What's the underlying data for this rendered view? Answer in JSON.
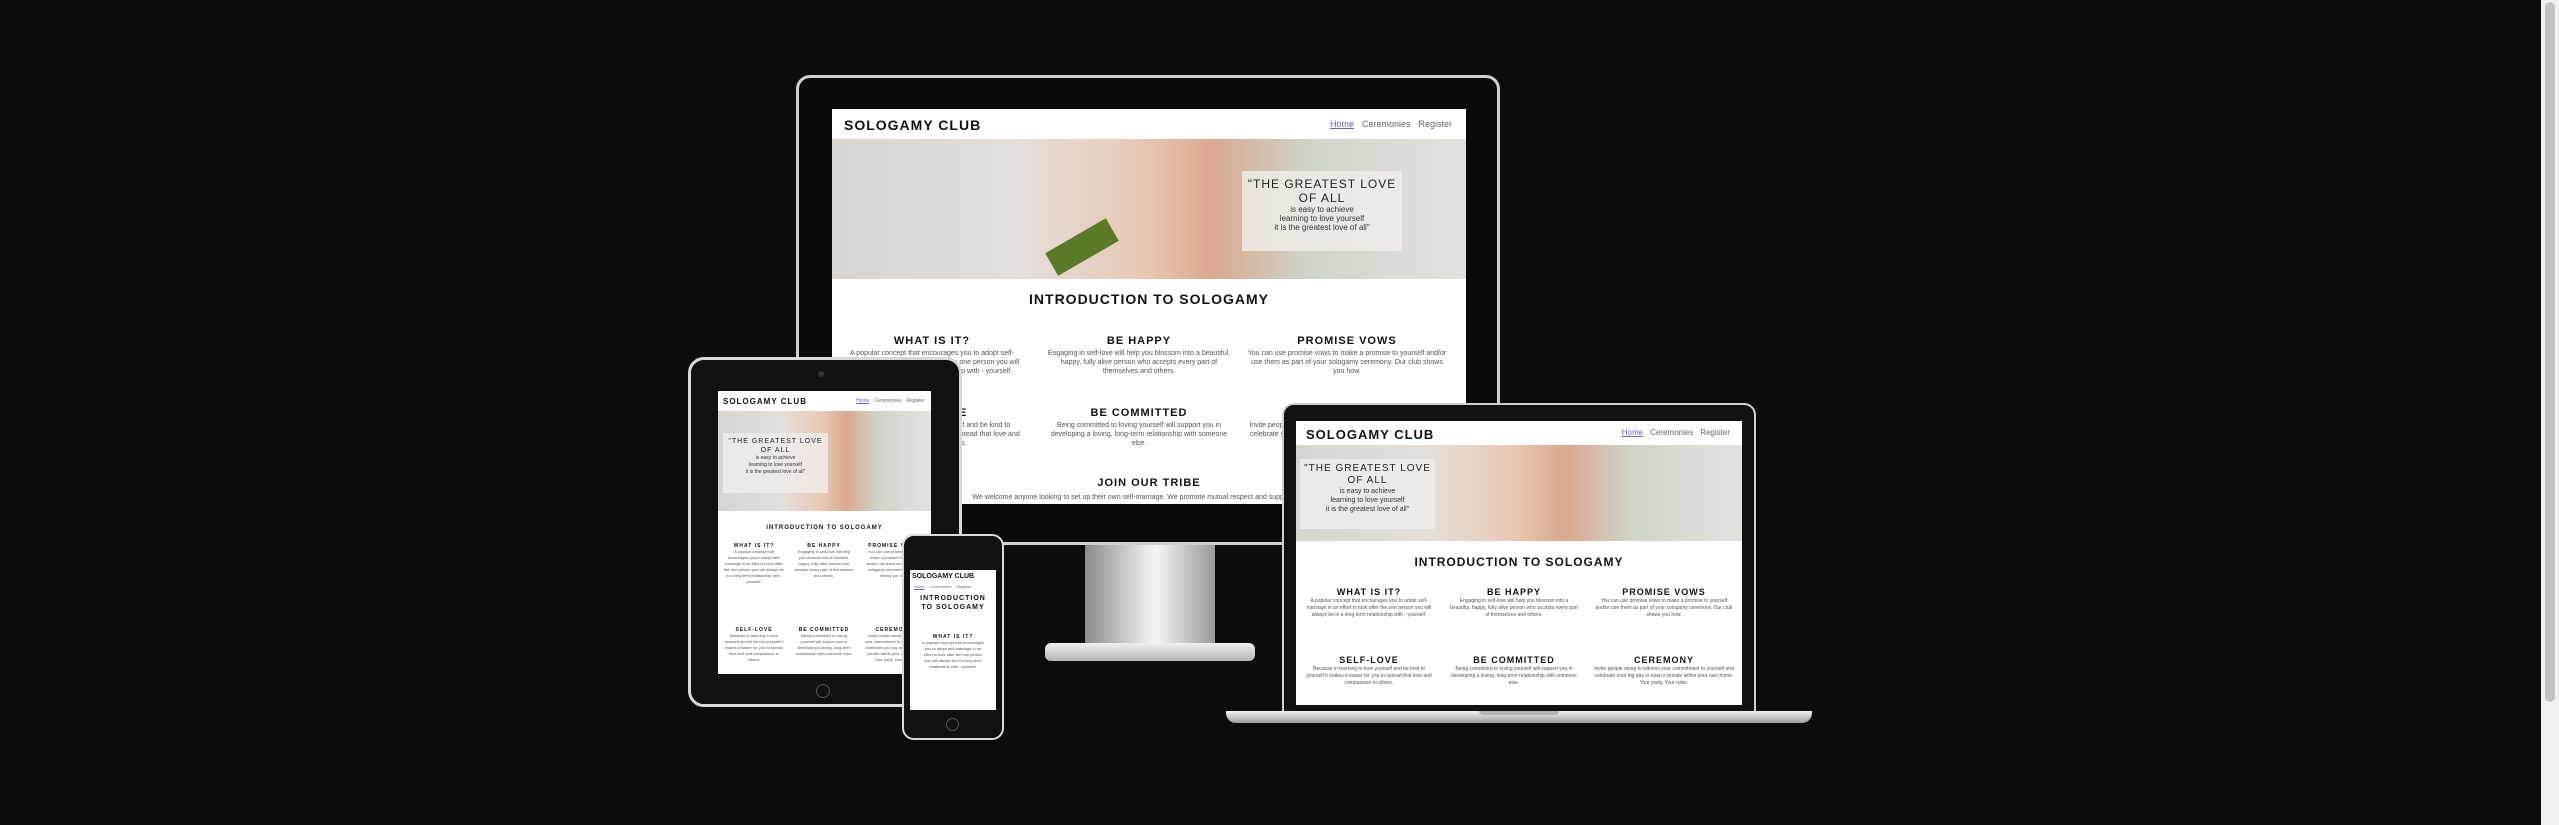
{
  "site": {
    "brand": "SOLOGAMY CLUB",
    "nav": [
      "Home",
      "Ceremonies",
      "Register"
    ],
    "quote_title": "\"THE GREATEST LOVE OF ALL",
    "quote_lines": [
      "is easy to achieve",
      "learning to love yourself",
      "it is the greatest love of all\""
    ],
    "intro_title": "INTRODUCTION TO SOLOGAMY",
    "sections": [
      {
        "title": "WHAT IS IT?",
        "text": "A popular concept that encourages you to adopt self-marriage in an effort to look after the one person you will always be in a long term relationship with - yourself."
      },
      {
        "title": "BE HAPPY",
        "text": "Engaging in self-love will help you blossom into a beautiful, happy, fully alive person who accepts every part of themselves and others."
      },
      {
        "title": "PROMISE VOWS",
        "text": "You can use promise vows to make a promise to yourself and/or use them as part of your sologamy ceremony. Our club shows you how."
      },
      {
        "title": "SELF-LOVE",
        "text": "Because in learning to love yourself and be kind to yourself it makes it easier for you to spread that love and compassion to others."
      },
      {
        "title": "BE COMMITTED",
        "text": "Being committed to loving yourself will support you in developing a loving, long-term relationship with someone else."
      },
      {
        "title": "CEREMONY",
        "text": "Invite people along to witness your commitment to yourself and celebrate your big day or keep it private within your own home. Your party, Your rules."
      }
    ],
    "tribe_title": "JOIN OUR TRIBE",
    "tribe_text": "We welcome anyone looking to set up their own self-marriage. We promote mutual respect and support along with"
  }
}
